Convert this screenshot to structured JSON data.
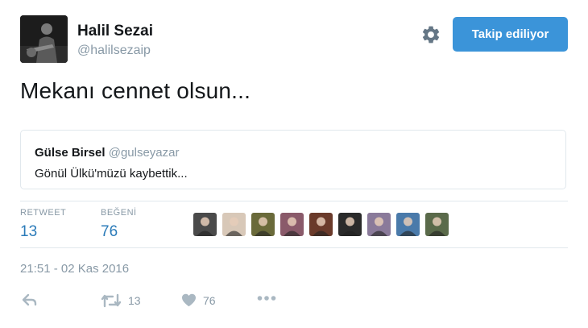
{
  "author": {
    "name": "Halil Sezai",
    "handle": "@halilsezaip"
  },
  "follow_button_label": "Takip ediliyor",
  "tweet_text": "Mekanı cennet olsun...",
  "quoted_tweet": {
    "name": "Gülse Birsel",
    "handle": "@gulseyazar",
    "text": "Gönül Ülkü'müzü kaybettik..."
  },
  "stats": {
    "retweet_label": "RETWEET",
    "retweet_count": "13",
    "like_label": "BEĞENİ",
    "like_count": "76"
  },
  "liker_avatars": [
    {
      "icon": "person-silhouette",
      "color": "#4a4a4a"
    },
    {
      "icon": "person-face",
      "color": "#d8c8b8"
    },
    {
      "icon": "person-face",
      "color": "#6a6a3a"
    },
    {
      "icon": "person-face",
      "color": "#8a5a6a"
    },
    {
      "icon": "person-face",
      "color": "#6a3a2a"
    },
    {
      "icon": "person-face",
      "color": "#2a2a2a"
    },
    {
      "icon": "person-face",
      "color": "#8a7a9a"
    },
    {
      "icon": "person-face",
      "color": "#4a7aaa"
    },
    {
      "icon": "person-face",
      "color": "#5a6a4a"
    }
  ],
  "timestamp": "21:51 - 02 Kas 2016",
  "actions": {
    "retweet_count": "13",
    "like_count": "76"
  },
  "colors": {
    "accent": "#3b94d9",
    "stat_value": "#2b7bb9",
    "muted": "#8899a6",
    "border": "#e1e8ed"
  }
}
